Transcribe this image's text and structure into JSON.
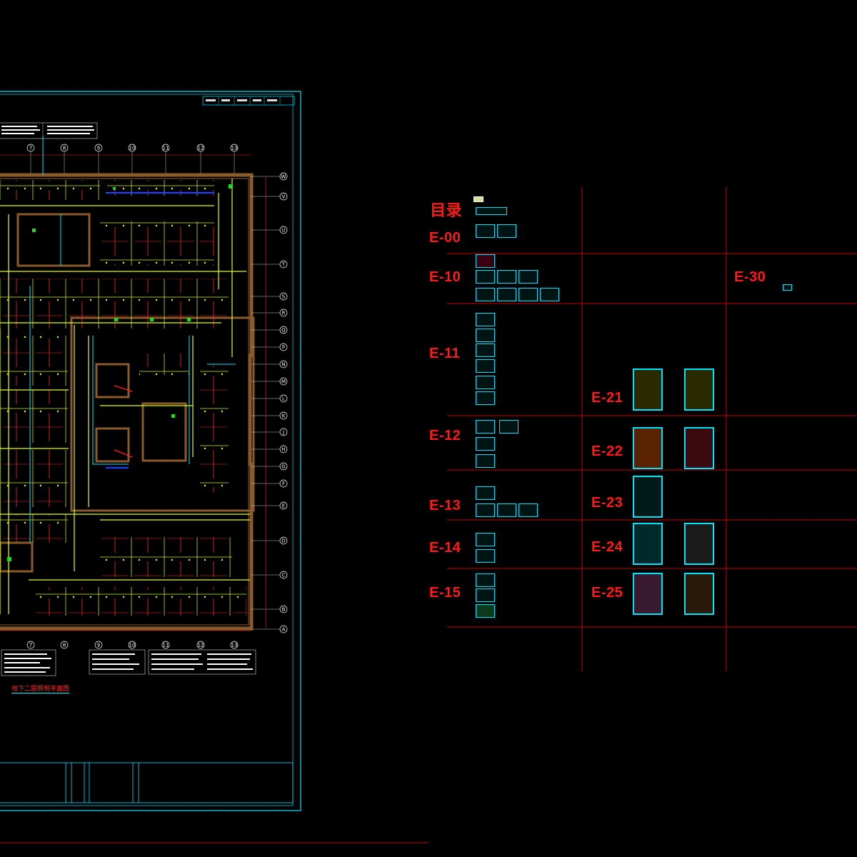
{
  "drawing_sheet": {
    "plan_caption": "地下二层照明平面图",
    "column_axes_top": [
      "7",
      "8",
      "9",
      "10",
      "11",
      "12",
      "13"
    ],
    "row_axes_right": [
      "W",
      "V",
      "U",
      "T",
      "S",
      "R",
      "Q",
      "P",
      "N",
      "M",
      "L",
      "K",
      "J",
      "H",
      "G",
      "F",
      "E",
      "D",
      "C",
      "B",
      "A"
    ]
  },
  "catalog": {
    "title": "目录",
    "labels": [
      "E-00",
      "E-10",
      "E-11",
      "E-12",
      "E-13",
      "E-14",
      "E-15",
      "E-21",
      "E-22",
      "E-23",
      "E-24",
      "E-25",
      "E-30"
    ]
  },
  "colors": {
    "background": "#000000",
    "frame_cyan": "#00e5ff",
    "label_red": "#ff1a1a",
    "wall_brown": "#8b5a2b",
    "wire_yellow": "#e6ff00",
    "grid_red": "#cc0000"
  }
}
